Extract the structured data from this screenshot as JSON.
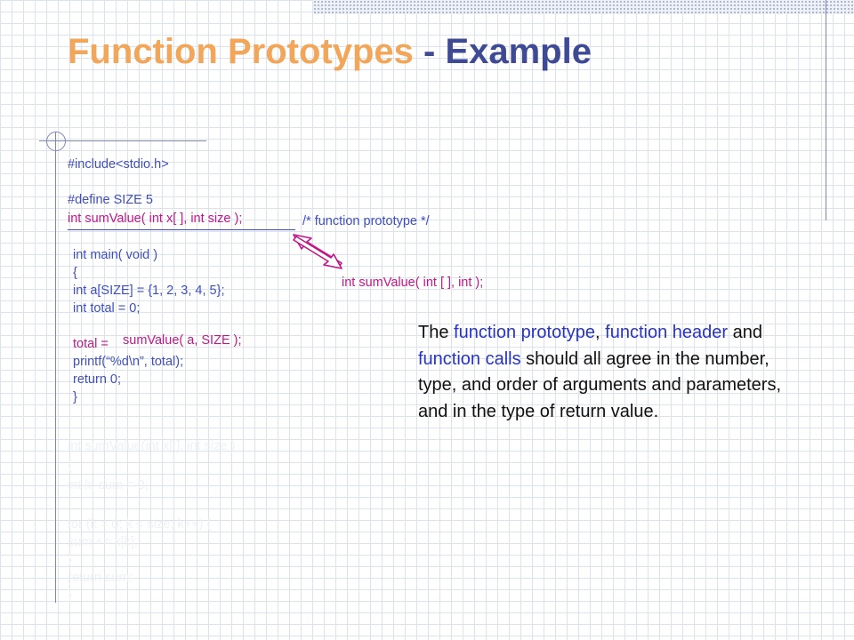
{
  "title": {
    "part1": "Function Prototypes",
    "part2": " - Example"
  },
  "code": {
    "include": "#include<stdio.h>",
    "define": "#define SIZE 5",
    "prototype": "int sumValue( int x[ ], int size );",
    "prototype_comment": "/* function prototype */",
    "alt_prototype": "int sumValue( int [ ], int );",
    "main_lines": [
      "int main( void )",
      "{",
      "int a[SIZE] = {1, 2, 3, 4, 5};",
      "int total = 0;"
    ],
    "call_lhs": "total =",
    "call_rhs": "sumValue( a, SIZE );",
    "main_tail": [
      "printf(“%d\\n”, total);",
      "return 0;",
      "}"
    ],
    "def_lines": [
      "int sumValue(int x[ ], int size )",
      "{",
      "int k, sum = 0;",
      "",
      "for  (k = 0; k < size; k++) {",
      "     sum += x[k];",
      "}",
      "return sum;",
      "}"
    ]
  },
  "description": {
    "p1": "The ",
    "h1": "function prototype",
    "p2": ", ",
    "h2": "function header",
    "p3": " and ",
    "h3": "function calls",
    "p4": " should all agree in the number, type, and order of arguments and parameters, and in the type of return value."
  },
  "colors": {
    "title_accent": "#f2a65a",
    "title_main": "#3f4a95",
    "code_blue": "#3f4fc2",
    "code_magenta": "#c0188a",
    "highlight": "#2733c8"
  },
  "icons": {
    "arrow": "double-arrow-icon"
  }
}
